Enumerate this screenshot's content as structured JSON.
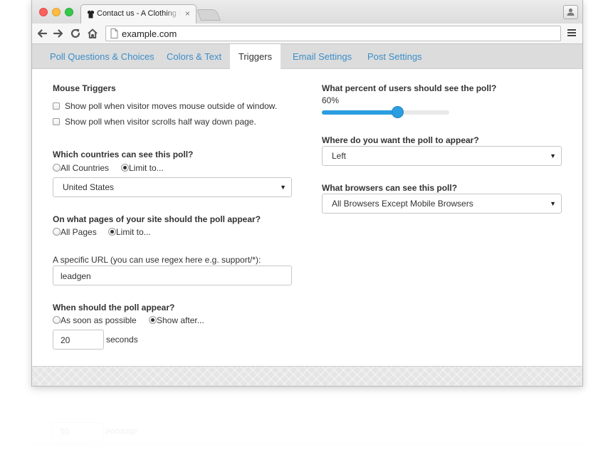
{
  "browser": {
    "tab_title": "Contact us - A Clothing St",
    "tab_close": "×",
    "url": "example.com"
  },
  "app": {
    "tabs": [
      {
        "label": "Poll Questions & Choices"
      },
      {
        "label": "Colors & Text"
      },
      {
        "label": "Triggers"
      },
      {
        "label": "Email Settings"
      },
      {
        "label": "Post Settings"
      }
    ],
    "active_tab": "Triggers",
    "mouse_triggers": {
      "heading": "Mouse Triggers",
      "options": [
        {
          "label": "Show poll when visitor moves mouse outside of window.",
          "checked": false
        },
        {
          "label": "Show poll when visitor scrolls half way down page.",
          "checked": false
        }
      ]
    },
    "countries": {
      "heading": "Which countries can see this poll?",
      "opt_all": "All Countries",
      "opt_limit": "Limit to...",
      "selected": "limit",
      "select_value": "United States"
    },
    "pages": {
      "heading": "On what pages of your site should the poll appear?",
      "opt_all": "All Pages",
      "opt_limit": "Limit to...",
      "selected": "limit"
    },
    "url_filter": {
      "label": "A specific URL (you can use regex here e.g. support/*):",
      "value": "leadgen"
    },
    "timing": {
      "heading": "When should the poll appear?",
      "opt_asap": "As soon as possible",
      "opt_after": "Show after...",
      "selected": "after",
      "seconds_value": "20",
      "seconds_label": "seconds"
    },
    "percent": {
      "heading": "What percent of users should see the poll?",
      "value_label": "60%",
      "value": 0.6
    },
    "position": {
      "heading": "Where do you want the poll to appear?",
      "select_value": "Left"
    },
    "browsers": {
      "heading": "What browsers can see this poll?",
      "select_value": "All Browsers Except Mobile Browsers"
    }
  },
  "colors": {
    "accent": "#2a9ee0",
    "tab_link": "#3b8ec9"
  }
}
